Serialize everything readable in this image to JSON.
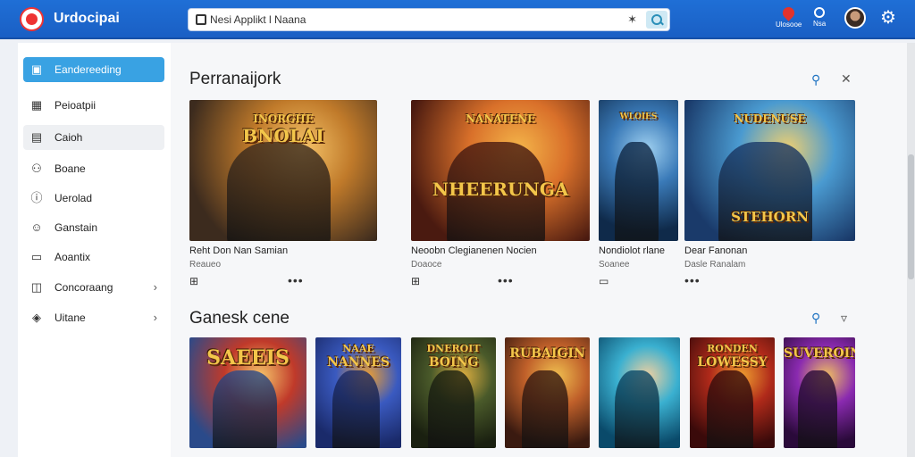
{
  "app": {
    "title": "Urdocipai"
  },
  "search": {
    "value": "Nesi Applikt l Naana",
    "placeholder": "Nesi Applikt l Naana"
  },
  "toolbar": {
    "notifications_label": "Ulosooe",
    "search_label": "Nsa"
  },
  "sidebar": {
    "items": [
      {
        "label": "Eandereeding",
        "icon": "store-icon",
        "active": true
      },
      {
        "label": "Peioatpii",
        "icon": "calendar-icon"
      },
      {
        "label": "Caioh",
        "icon": "catalog-icon"
      },
      {
        "label": "Boane",
        "icon": "people-icon"
      },
      {
        "label": "Uerolad",
        "icon": "info-icon"
      },
      {
        "label": "Ganstain",
        "icon": "smile-icon"
      },
      {
        "label": "Aoantix",
        "icon": "chat-icon"
      },
      {
        "label": "Concoraang",
        "icon": "bookmark-icon",
        "chevron": true
      },
      {
        "label": "Uitane",
        "icon": "lock-icon",
        "chevron": true
      }
    ]
  },
  "sections": [
    {
      "title": "Perranaijork",
      "action1": "search-icon",
      "action2": "close-icon",
      "cards": [
        {
          "name": "Reht Don Nan Samian",
          "sub": "Reaueo",
          "logo": "BNOLAI",
          "logo_top": "INORGHE",
          "colors": [
            "#3c2b1e",
            "#c07a2a",
            "#f6c56a"
          ]
        },
        {
          "name": "Neoobn Clegianenen Nocien",
          "sub": "Doaoce",
          "logo": "NHEERUNGA",
          "logo_top": "NANATENE",
          "colors": [
            "#4a1a10",
            "#d9702a",
            "#f4b54a"
          ]
        },
        {
          "name": "Nondiolot rlane",
          "sub": "Soanee",
          "logo": "",
          "logo_top": "WLOIES",
          "colors": [
            "#0f2a4a",
            "#3a7ab8",
            "#9fd0f0"
          ]
        },
        {
          "name": "Dear Fanonan",
          "sub": "Dasle Ranalam",
          "logo": "STEHORN",
          "logo_top": "NUDENUSE",
          "colors": [
            "#1a3a6a",
            "#4a9ad0",
            "#f0d070"
          ]
        }
      ]
    },
    {
      "title": "Ganesk cene",
      "action1": "search-icon",
      "action2": "filter-icon",
      "cards": [
        {
          "logo": "SAEEIS",
          "colors": [
            "#2a4a8a",
            "#c03a2a",
            "#f6c56a"
          ]
        },
        {
          "logo": "NANNES",
          "logo_top": "NAAE",
          "colors": [
            "#1a2a6a",
            "#3a5ac0",
            "#f0a030"
          ]
        },
        {
          "logo": "BOING",
          "logo_top": "DNEROIT",
          "colors": [
            "#1a2010",
            "#4a5a2a",
            "#e0b040"
          ]
        },
        {
          "logo": "RUBAIGIN",
          "colors": [
            "#3a1a10",
            "#c0602a",
            "#f0c050"
          ]
        },
        {
          "logo": "",
          "colors": [
            "#0a4a6a",
            "#3ab0d0",
            "#f0d0a0"
          ]
        },
        {
          "logo": "LOWESSY",
          "logo_top": "RONDEN",
          "colors": [
            "#3a0a0a",
            "#b02a1a",
            "#f0a030"
          ]
        },
        {
          "logo": "SUVEROIN",
          "colors": [
            "#2a0a3a",
            "#8a2ab0",
            "#f0c060"
          ]
        }
      ]
    }
  ]
}
